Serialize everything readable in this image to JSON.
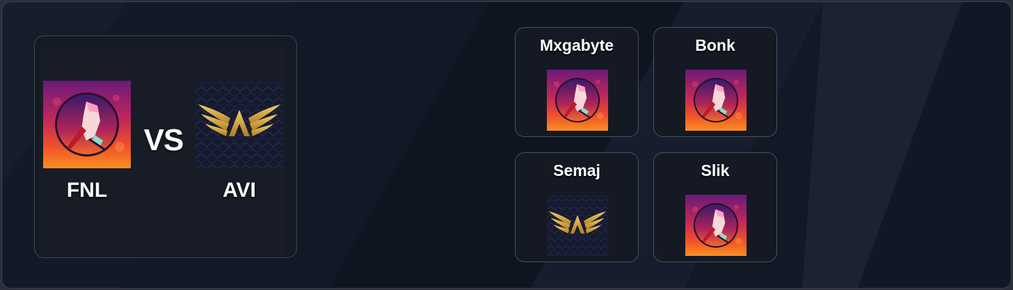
{
  "match": {
    "team_a": {
      "name": "FNL",
      "logo": "fist-knife-logo"
    },
    "vs_label": "VS",
    "team_b": {
      "name": "AVI",
      "logo": "gold-wings-logo"
    }
  },
  "players": [
    {
      "name": "Mxgabyte",
      "logo": "fist-knife-logo"
    },
    {
      "name": "Bonk",
      "logo": "fist-knife-logo"
    },
    {
      "name": "Semaj",
      "logo": "gold-wings-logo"
    },
    {
      "name": "Slik",
      "logo": "fist-knife-logo"
    }
  ],
  "colors": {
    "background": "#121826",
    "panel_border": "#3f4656",
    "text": "#ffffff",
    "gold": "#d4a63c"
  }
}
